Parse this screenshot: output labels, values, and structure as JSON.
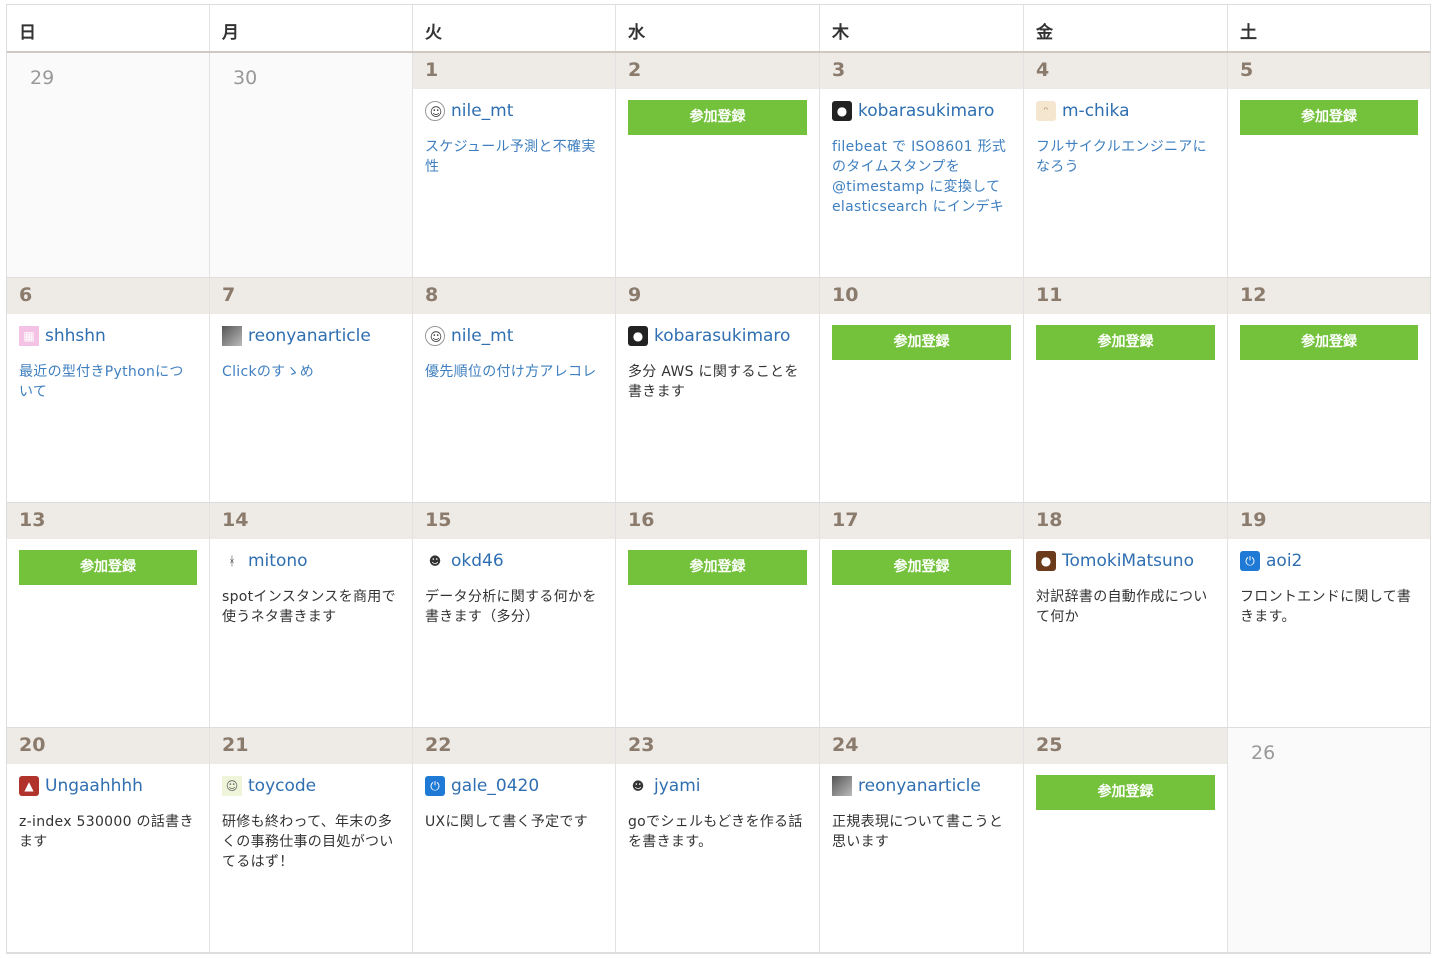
{
  "weekdays": [
    "日",
    "月",
    "火",
    "水",
    "木",
    "金",
    "土"
  ],
  "register_label": "参加登録",
  "weeks": [
    [
      {
        "day": "29",
        "inactive": true
      },
      {
        "day": "30",
        "inactive": true
      },
      {
        "day": "1",
        "user": "nile_mt",
        "avatar": "face",
        "title": "スケジュール予測と不確実性",
        "link": true
      },
      {
        "day": "2",
        "register": true
      },
      {
        "day": "3",
        "user": "kobarasukimaro",
        "avatar": "dark",
        "title": "filebeat で ISO8601 形式のタイムスタンプを @timestamp に変換して elasticsearch にインデキ",
        "link": true
      },
      {
        "day": "4",
        "user": "m-chika",
        "avatar": "cat",
        "title": "フルサイクルエンジニアになろう",
        "link": true
      },
      {
        "day": "5",
        "register": true
      }
    ],
    [
      {
        "day": "6",
        "user": "shhshn",
        "avatar": "pink",
        "title": "最近の型付きPythonについて",
        "link": true
      },
      {
        "day": "7",
        "user": "reonyanarticle",
        "avatar": "photo",
        "title": "Clickのすゝめ",
        "link": true
      },
      {
        "day": "8",
        "user": "nile_mt",
        "avatar": "face",
        "title": "優先順位の付け方アレコレ",
        "link": true
      },
      {
        "day": "9",
        "user": "kobarasukimaro",
        "avatar": "dark",
        "title": "多分 AWS に関することを書きます",
        "link": false
      },
      {
        "day": "10",
        "register": true
      },
      {
        "day": "11",
        "register": true
      },
      {
        "day": "12",
        "register": true
      }
    ],
    [
      {
        "day": "13",
        "register": true
      },
      {
        "day": "14",
        "user": "mitono",
        "avatar": "stick",
        "title": "spotインスタンスを商用で使うネタ書きます",
        "link": false
      },
      {
        "day": "15",
        "user": "okd46",
        "avatar": "fig",
        "title": "データ分析に関する何かを書きます（多分）",
        "link": false
      },
      {
        "day": "16",
        "register": true
      },
      {
        "day": "17",
        "register": true
      },
      {
        "day": "18",
        "user": "TomokiMatsuno",
        "avatar": "brown",
        "title": "対訳辞書の自動作成について何か",
        "link": false
      },
      {
        "day": "19",
        "user": "aoi2",
        "avatar": "power",
        "title": "フロントエンドに関して書きます。",
        "link": false
      }
    ],
    [
      {
        "day": "20",
        "user": "Ungaahhhh",
        "avatar": "red",
        "title": "z-index 530000 の話書きます",
        "link": false
      },
      {
        "day": "21",
        "user": "toycode",
        "avatar": "green",
        "title": "研修も終わって、年末の多くの事務仕事の目処がついてるはず！",
        "link": false
      },
      {
        "day": "22",
        "user": "gale_0420",
        "avatar": "power",
        "title": "UXに関して書く予定です",
        "link": false
      },
      {
        "day": "23",
        "user": "jyami",
        "avatar": "fig",
        "title": "goでシェルもどきを作る話を書きます。",
        "link": false
      },
      {
        "day": "24",
        "user": "reonyanarticle",
        "avatar": "photo",
        "title": "正規表現について書こうと思います",
        "link": false
      },
      {
        "day": "25",
        "register": true
      },
      {
        "day": "26",
        "inactive": true
      }
    ]
  ]
}
